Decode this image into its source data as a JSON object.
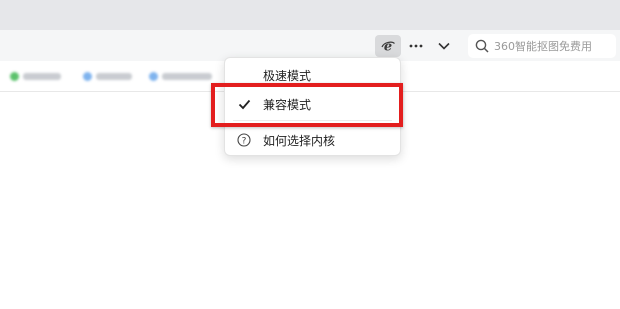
{
  "toolbar": {
    "kernel_icon": "ie-compat-icon",
    "more_icon": "more-horizontal-icon",
    "expand_icon": "chevron-down-icon",
    "search": {
      "placeholder": "360智能抠图免费用",
      "value": ""
    }
  },
  "kernel_menu": {
    "items": [
      {
        "label": "极速模式",
        "checked": false
      },
      {
        "label": "兼容模式",
        "checked": true,
        "check_icon": "checkmark-icon"
      },
      {
        "label": "如何选择内核",
        "icon": "help-circle-icon"
      }
    ]
  },
  "bookmarks": [
    {
      "icon_color": "#5cc26c"
    },
    {
      "icon_color": "#7fb3ee"
    },
    {
      "icon_color": "#7fb3ee"
    }
  ],
  "colors": {
    "highlight": "#e31e1e",
    "toolbar_bg": "#f5f6f7",
    "top_strip_bg": "#e6e7ea"
  }
}
